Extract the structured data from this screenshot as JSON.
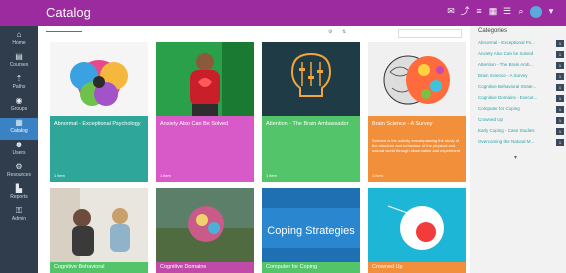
{
  "header": {
    "title": "Catalog"
  },
  "topbar_icons": [
    "mail-icon",
    "share-icon",
    "list-icon",
    "grid-icon",
    "list-alt-icon",
    "search-icon",
    "user-avatar",
    "chevron-down-icon"
  ],
  "sidebar": {
    "items": [
      {
        "label": "Home"
      },
      {
        "label": "Courses"
      },
      {
        "label": "Paths"
      },
      {
        "label": "Groups"
      },
      {
        "label": "Catalog"
      },
      {
        "label": "Users"
      },
      {
        "label": "Resources"
      },
      {
        "label": "Reports"
      },
      {
        "label": "Admin"
      }
    ]
  },
  "cards": [
    {
      "title": "Abnormal - Exceptional Psychology",
      "desc": "",
      "items": "1 item",
      "color": "#2ea79a"
    },
    {
      "title": "Anxiety Also Can Be Solved",
      "desc": "",
      "items": "1 item",
      "color": "#d85ac9"
    },
    {
      "title": "Attention - The Brain Ambassador",
      "desc": "",
      "items": "1 item",
      "color": "#53c46a"
    },
    {
      "title": "Brain Science - A Survey",
      "desc": "Science is the activity encompassing the study of the structure and behaviour of the physical and natural world through observation and experiment",
      "items": "1 item",
      "color": "#f28f3b"
    },
    {
      "title": "Cognitive Behavioral",
      "desc": "",
      "items": "",
      "color": "#53c46a"
    },
    {
      "title": "Cognitive Domains",
      "desc": "",
      "items": "",
      "color": "#c04aa8"
    },
    {
      "title": "Computer for Coping",
      "desc": "",
      "items": "",
      "color": "#53c46a"
    },
    {
      "title": "Crowned Up",
      "desc": "",
      "items": "",
      "color": "#f28f3b"
    }
  ],
  "panel": {
    "heading": "Categories",
    "items": [
      {
        "label": "Abnormal - Exceptional Ps...",
        "count": "1"
      },
      {
        "label": "Anxiety Also Can be Solved",
        "count": "1"
      },
      {
        "label": "Attention - The Brain Amb...",
        "count": "1"
      },
      {
        "label": "Brain Science - A Survey",
        "count": "1"
      },
      {
        "label": "Cognitive Behavioral Strate...",
        "count": "1"
      },
      {
        "label": "Cognitive Domains - Execut...",
        "count": "1"
      },
      {
        "label": "Computer for Coping",
        "count": "1"
      },
      {
        "label": "Crowned Up",
        "count": "1"
      },
      {
        "label": "Early Coping - Case Studies",
        "count": "1"
      },
      {
        "label": "Overcoming the Natural M...",
        "count": "1"
      }
    ]
  }
}
